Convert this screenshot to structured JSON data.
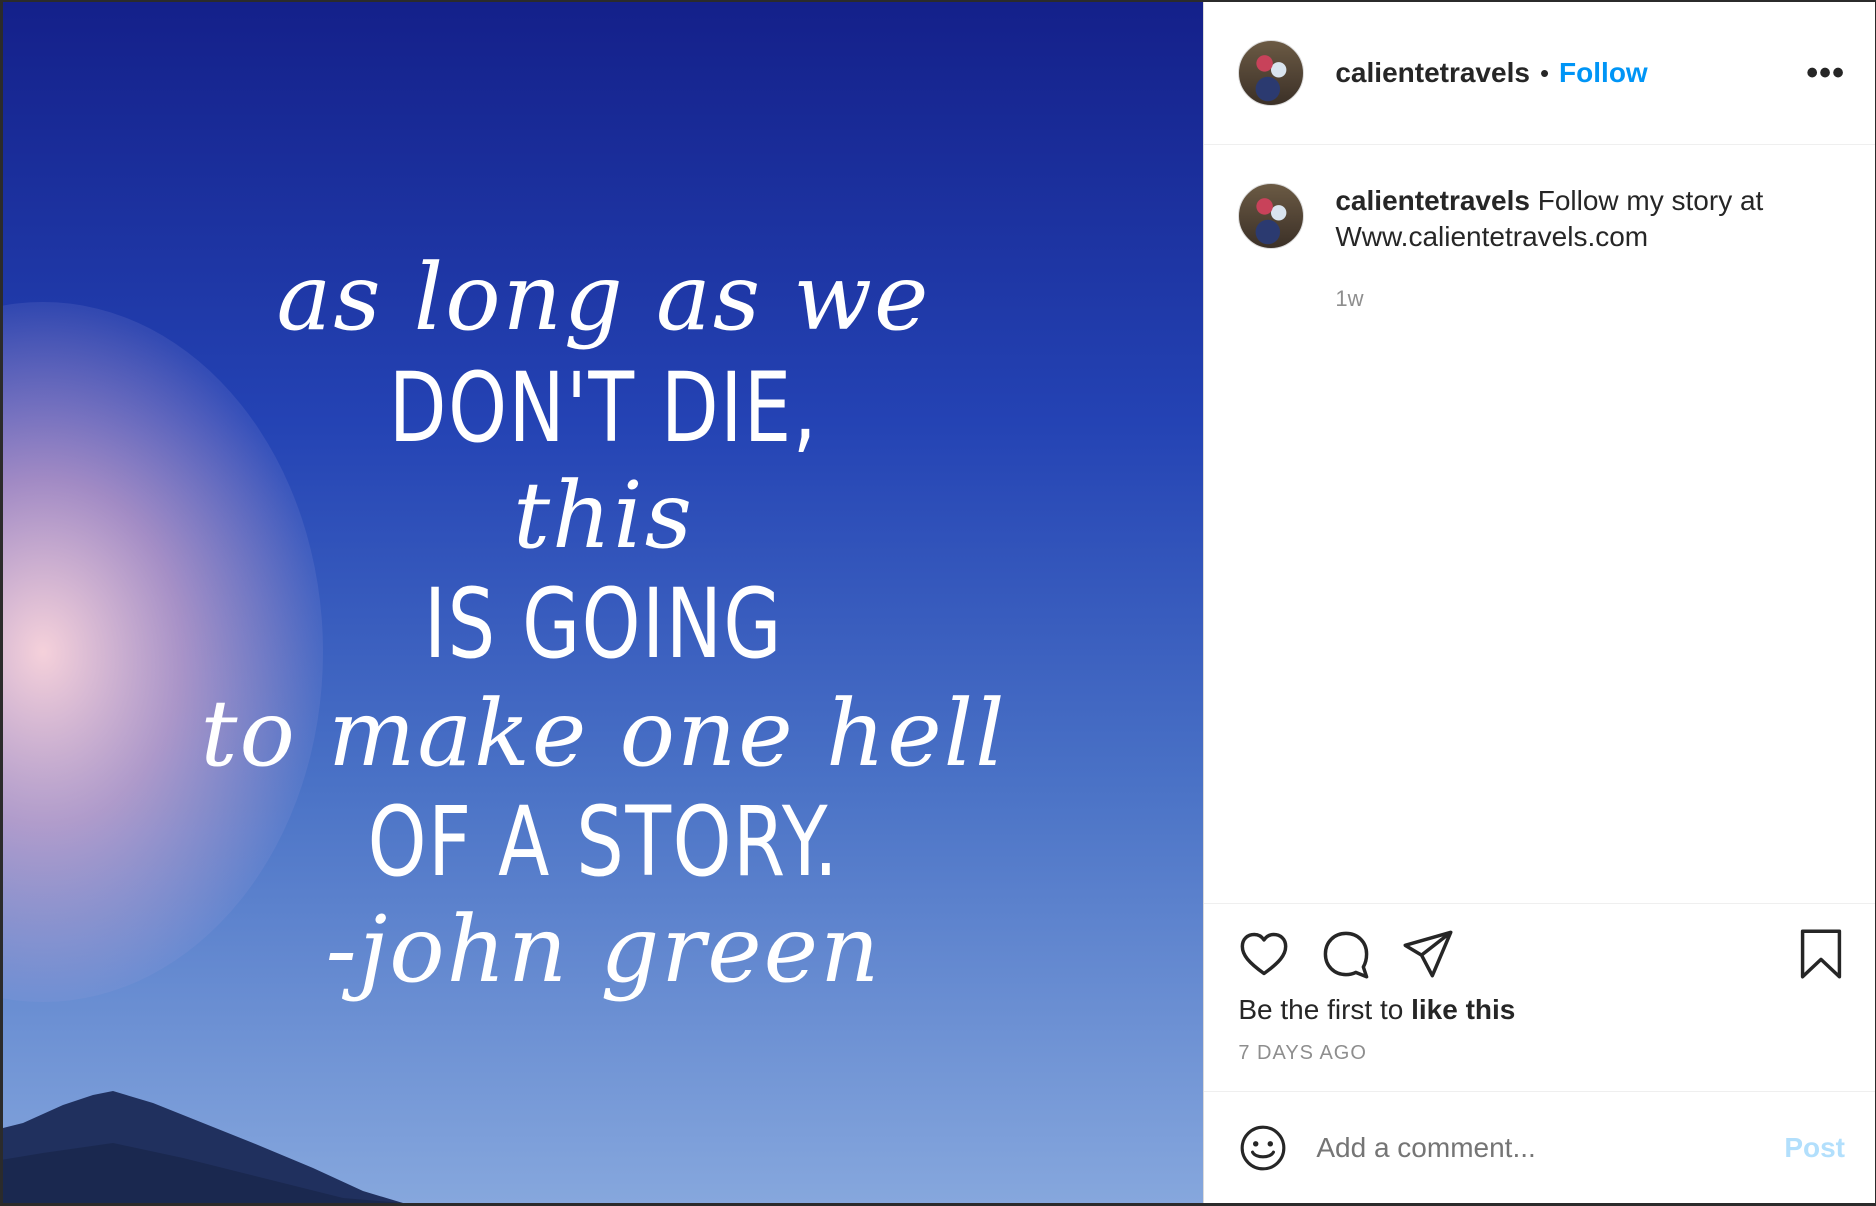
{
  "post": {
    "quote_lines": [
      "as long as we",
      "DON'T DIE,",
      "this",
      "IS GOING",
      "to make one hell",
      "OF A STORY.",
      "-john green"
    ]
  },
  "header": {
    "username": "calientetravels",
    "separator": "•",
    "follow_label": "Follow",
    "more_label": "•••"
  },
  "caption": {
    "username": "calientetravels",
    "text": "Follow my story at Www.calientetravels.com",
    "age": "1w"
  },
  "actions": {
    "likes_prefix": "Be the first to",
    "likes_link": "like this",
    "date": "7 DAYS AGO"
  },
  "comment": {
    "placeholder": "Add a comment...",
    "post_label": "Post"
  },
  "colors": {
    "follow": "#0095f6",
    "post_disabled": "#b2dffc"
  }
}
